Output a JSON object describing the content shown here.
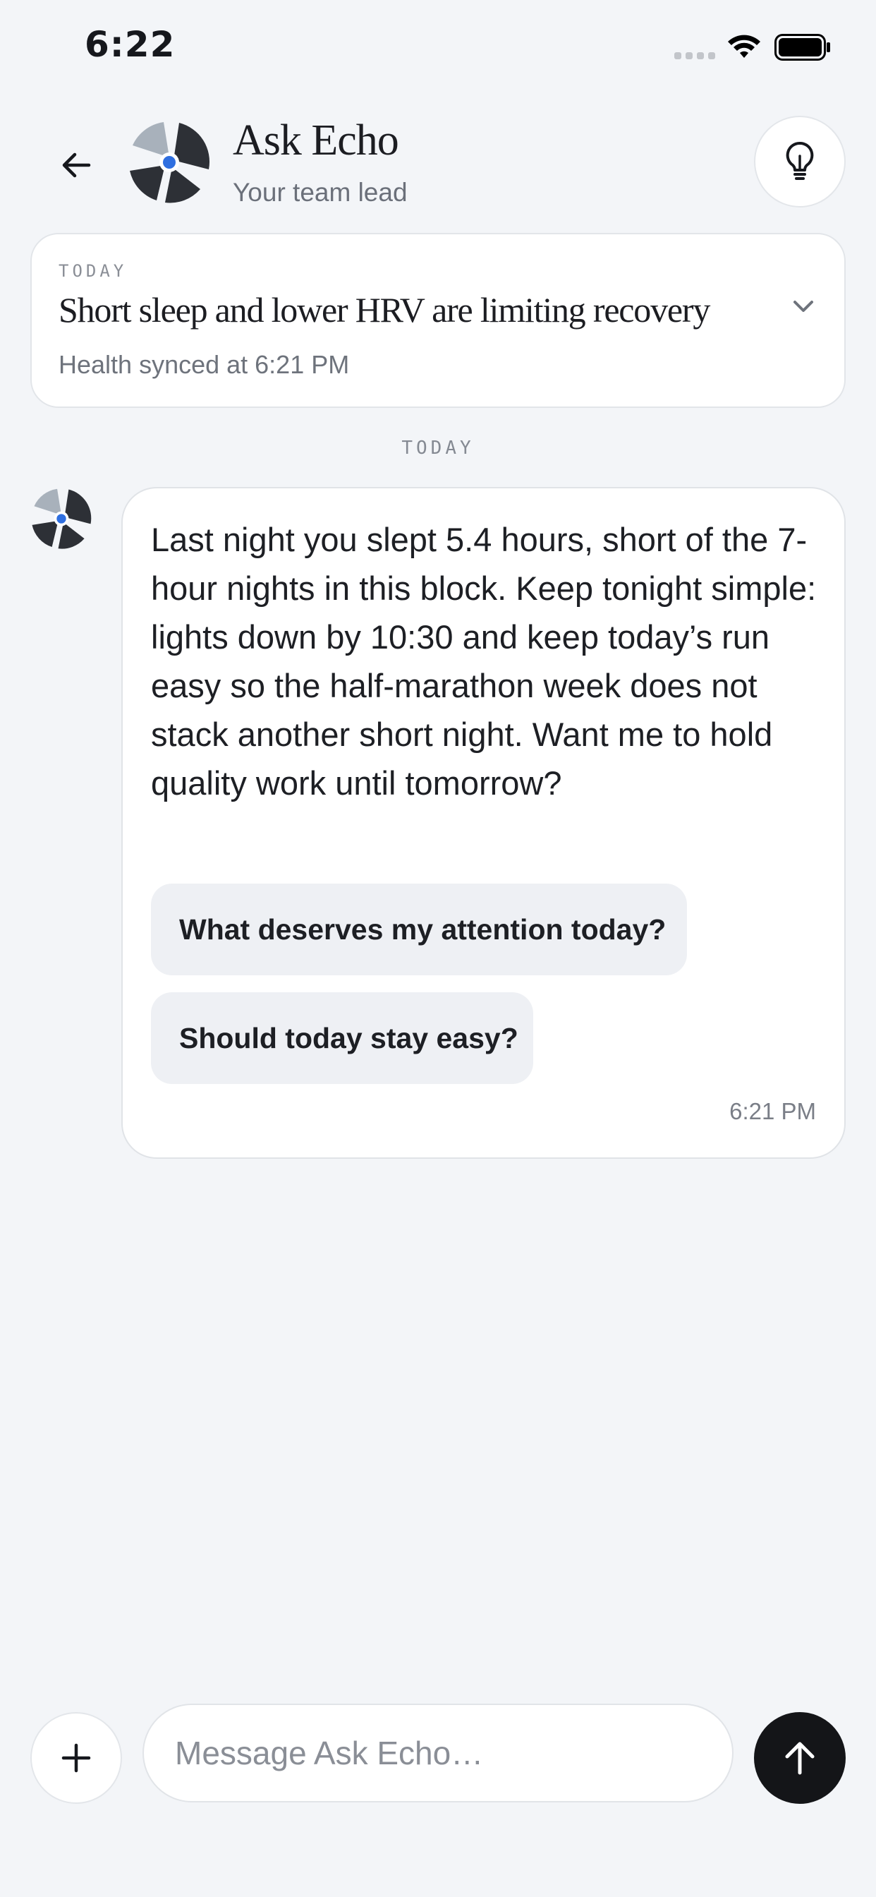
{
  "status_bar": {
    "time": "6:22",
    "icons": [
      "cellular-signal-icon",
      "wifi-icon",
      "battery-icon"
    ]
  },
  "header": {
    "title": "Ask Echo",
    "subtitle": "Your team lead",
    "icons": [
      "back-arrow-icon",
      "echo-logo-icon",
      "lightbulb-icon"
    ]
  },
  "summary_card": {
    "eyebrow": "TODAY",
    "headline": "Short sleep and lower HRV are limiting recovery",
    "sync_status": "Health synced at 6:21 PM",
    "toggle_icon": "chevron-down-icon"
  },
  "day_divider": "TODAY",
  "message": {
    "text": "Last night you slept 5.4 hours, short of the 7-hour nights in this block. Keep tonight simple: lights down by 10:30 and keep today’s run easy so the half-marathon week does not stack another short night. Want me to hold quality work until tomorrow?",
    "suggestions": [
      "What deserves my attention today?",
      "Should today stay easy?"
    ],
    "time": "6:21 PM"
  },
  "composer": {
    "placeholder": "Message Ask Echo…",
    "value": "",
    "icons": [
      "plus-icon",
      "arrow-up-icon"
    ]
  },
  "colors": {
    "background": "#f3f5f8",
    "accent_blue": "#2f6fe0",
    "dark": "#2d3036",
    "logo_gray": "#a8b1bb",
    "send_button": "#141518"
  }
}
